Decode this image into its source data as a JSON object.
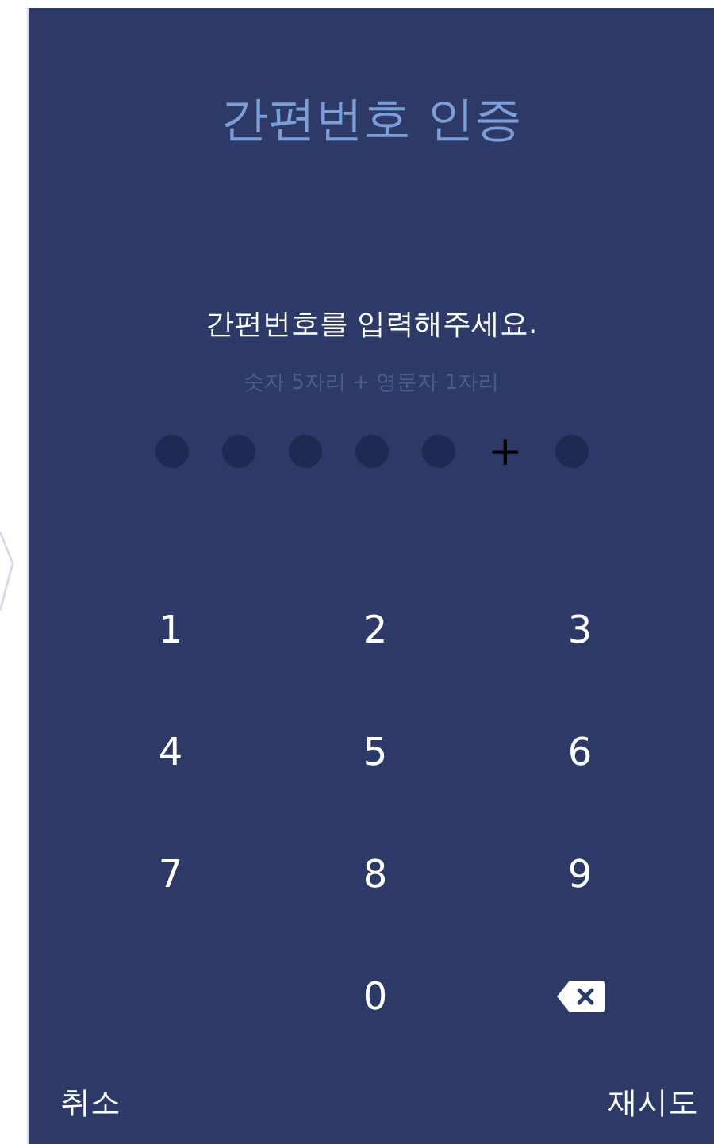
{
  "title": "간편번호 인증",
  "prompt": "간편번호를 입력해주세요.",
  "hint": "숫자 5자리 + 영문자 1자리",
  "pin_slots": [
    {
      "kind": "dot",
      "filled": false
    },
    {
      "kind": "dot",
      "filled": false
    },
    {
      "kind": "dot",
      "filled": false
    },
    {
      "kind": "dot",
      "filled": false
    },
    {
      "kind": "dot",
      "filled": false
    },
    {
      "kind": "separator",
      "text": "+"
    },
    {
      "kind": "dot",
      "filled": false
    }
  ],
  "keypad": [
    {
      "kind": "digit",
      "text": "1"
    },
    {
      "kind": "digit",
      "text": "2"
    },
    {
      "kind": "digit",
      "text": "3"
    },
    {
      "kind": "digit",
      "text": "4"
    },
    {
      "kind": "digit",
      "text": "5"
    },
    {
      "kind": "digit",
      "text": "6"
    },
    {
      "kind": "digit",
      "text": "7"
    },
    {
      "kind": "digit",
      "text": "8"
    },
    {
      "kind": "digit",
      "text": "9"
    },
    {
      "kind": "blank"
    },
    {
      "kind": "digit",
      "text": "0"
    },
    {
      "kind": "backspace"
    }
  ],
  "footer": {
    "cancel": "취소",
    "retry": "재시도"
  }
}
